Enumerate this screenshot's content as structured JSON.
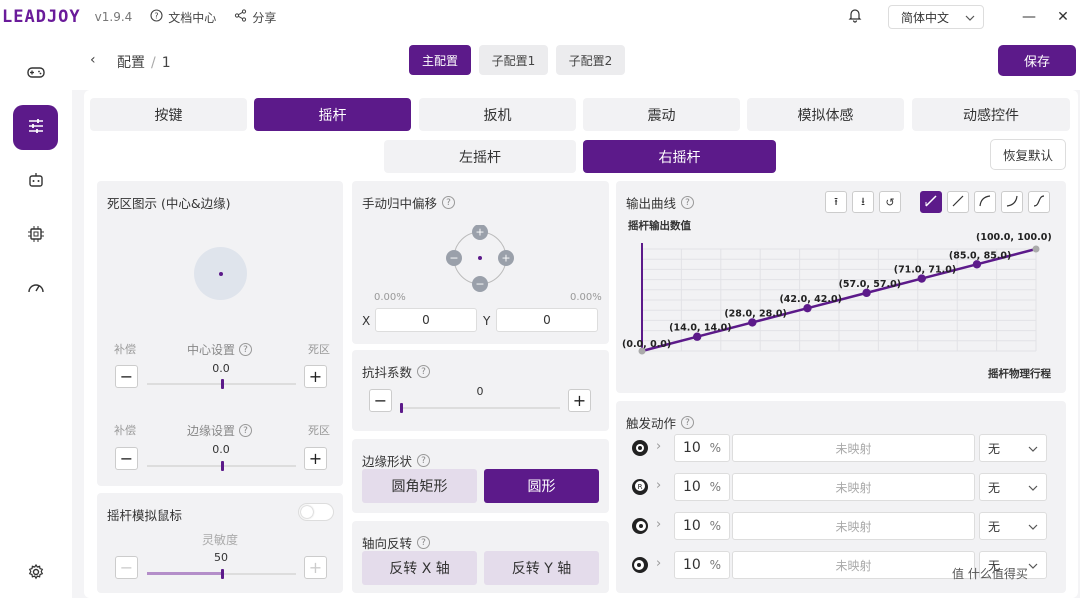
{
  "app": {
    "logo": "LEADJOY",
    "version": "v1.9.4",
    "docs": "文档中心",
    "share": "分享",
    "language": "简体中文"
  },
  "nav": {
    "crumb_root": "配置",
    "crumb_sep": "/",
    "crumb_current": "1",
    "config_tabs": [
      "主配置",
      "子配置1",
      "子配置2"
    ],
    "save": "保存"
  },
  "tabs": [
    "按键",
    "摇杆",
    "扳机",
    "震动",
    "模拟体感",
    "动感控件"
  ],
  "subtabs": [
    "左摇杆",
    "右摇杆"
  ],
  "restore": "恢复默认",
  "deadzone": {
    "title": "死区图示 (中心&边缘)",
    "center_title": "中心设置",
    "edge_title": "边缘设置",
    "left_label": "补偿",
    "right_label": "死区",
    "center_value": "0.0",
    "edge_value": "0.0",
    "center_fraction": 0.5,
    "edge_fraction": 0.5
  },
  "mouse": {
    "title": "摇杆模拟鼠标",
    "sensitivity_label": "灵敏度",
    "sensitivity_value": "50",
    "sensitivity_fraction": 0.5
  },
  "manual_center": {
    "title": "手动归中偏移",
    "left_pct": "0.00%",
    "right_pct": "0.00%",
    "x_label": "X",
    "x_value": "0",
    "y_label": "Y",
    "y_value": "0"
  },
  "antishake": {
    "title": "抗抖系数",
    "value": "0",
    "fraction": 0.0
  },
  "edge_shape": {
    "title": "边缘形状",
    "options": [
      "圆角矩形",
      "圆形"
    ],
    "selected": "圆形"
  },
  "axis_invert": {
    "title": "轴向反转",
    "options": [
      "反转 X 轴",
      "反转 Y 轴"
    ]
  },
  "curve": {
    "title": "输出曲线",
    "ylabel": "摇杆输出数值",
    "xlabel": "摇杆物理行程"
  },
  "chart_data": {
    "type": "line",
    "title": "输出曲线",
    "xlabel": "摇杆物理行程",
    "ylabel": "摇杆输出数值",
    "x": [
      0,
      14,
      28,
      42,
      57,
      71,
      85,
      100
    ],
    "series": [
      {
        "values": [
          0,
          14,
          28,
          42,
          57,
          71,
          85,
          100
        ]
      }
    ],
    "point_labels": [
      "(0.0, 0.0)",
      "(14.0, 14.0)",
      "(28.0, 28.0)",
      "(42.0, 42.0)",
      "(57.0, 57.0)",
      "(71.0, 71.0)",
      "(85.0, 85.0)",
      "(100.0, 100.0)"
    ],
    "xlim": [
      0,
      100
    ],
    "ylim": [
      0,
      100
    ],
    "grid": true,
    "color": "#5c1a8a"
  },
  "trigger": {
    "title": "触发动作",
    "rows": [
      {
        "value": "10",
        "unit": "%",
        "mapping": "未映射",
        "select": "无"
      },
      {
        "value": "10",
        "unit": "%",
        "mapping": "未映射",
        "select": "无"
      },
      {
        "value": "10",
        "unit": "%",
        "mapping": "未映射",
        "select": "无"
      },
      {
        "value": "10",
        "unit": "%",
        "mapping": "未映射",
        "select": "无"
      }
    ]
  },
  "watermark": "值 什么值得买",
  "colors": {
    "accent": "#5c1a8a",
    "accent_light": "#b48ec9"
  }
}
